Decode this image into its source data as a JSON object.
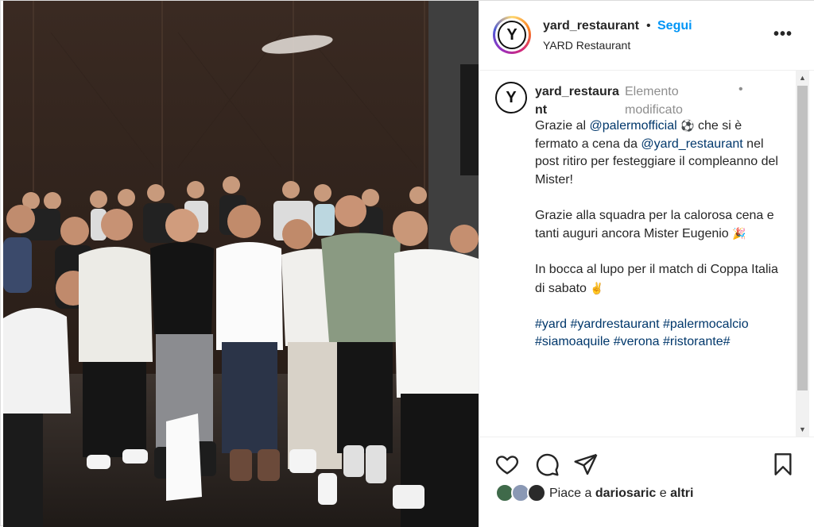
{
  "header": {
    "username": "yard_restaurant",
    "separator": "•",
    "follow_label": "Segui",
    "location": "YARD Restaurant",
    "more_label": "•••",
    "avatar_letter": "Y"
  },
  "caption": {
    "username_line1": "yard_restaura",
    "username_line2": "nt",
    "edited_line1": "Elemento",
    "edited_line2": "modificato",
    "dot": "•",
    "p1_a": "Grazie al ",
    "p1_mention1": "@palermofficial",
    "p1_emoji1": "⚽",
    "p1_b": " che si è fermato a cena da ",
    "p1_mention2": "@yard_restaurant",
    "p1_c": " nel post ritiro per festeggiare il compleanno del Mister!",
    "p2_a": "Grazie alla squadra per la calorosa cena e tanti auguri ancora Mister Eugenio ",
    "p2_emoji": "🎉",
    "p3_a": "In bocca al lupo per il match di Coppa Italia di sabato ",
    "p3_emoji": "✌",
    "hashtags": "#yard #yardrestaurant #palermocalcio #siamoaquile #verona #ristorante#"
  },
  "scrollbar": {
    "up": "▲",
    "down": "▼"
  },
  "actions": {
    "like_icon": "heart-icon",
    "comment_icon": "comment-icon",
    "share_icon": "send-icon",
    "save_icon": "bookmark-icon"
  },
  "likes": {
    "prefix": "Piace a ",
    "user": "dariosaric",
    "joiner": " e ",
    "others": "altri"
  },
  "colors": {
    "link": "#0095f6",
    "mention": "#00376b",
    "muted": "#8e8e8e"
  }
}
